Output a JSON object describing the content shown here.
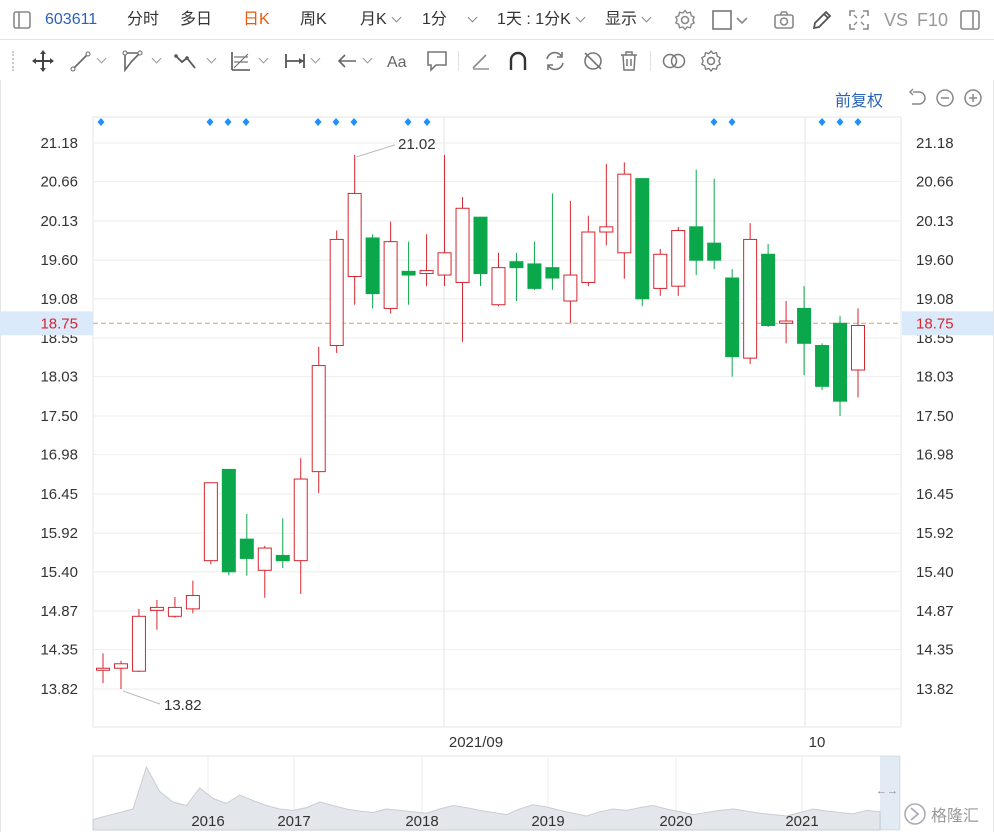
{
  "toolbar": {
    "stock_code": "603611",
    "tabs": [
      {
        "label": "分时",
        "active": false
      },
      {
        "label": "多日",
        "active": false
      },
      {
        "label": "日K",
        "active": true
      },
      {
        "label": "周K",
        "active": false
      },
      {
        "label": "月K",
        "active": false
      },
      {
        "label": "1分",
        "active": false
      }
    ],
    "period_select": "1天 : 1分K",
    "display_label": "显示",
    "vs_label": "VS",
    "f10_label": "F10"
  },
  "drawing_tools": [
    "move-icon",
    "line-tool-icon",
    "shape-tool-icon",
    "wave-tool-icon",
    "fib-tool-icon",
    "range-tool-icon",
    "arrow-tool-icon",
    "text-tool-icon",
    "note-tool-icon",
    "pen-tool-icon",
    "magnet-icon",
    "sync-icon",
    "hide-icon",
    "delete-icon",
    "compare-icon",
    "settings-icon"
  ],
  "price_mode": "前复权",
  "colors": {
    "up": "#d6262f",
    "down": "#0aa84b",
    "accent": "#2a62b8",
    "active_tab": "#e8590c",
    "current_line": "#e8a040",
    "marker": "#1e90ff"
  },
  "current_price": "18.75",
  "annotations": {
    "high": "21.02",
    "low": "13.82"
  },
  "date_labels": [
    "2021/09",
    "10"
  ],
  "overview_years": [
    "2016",
    "2017",
    "2018",
    "2019",
    "2020",
    "2021"
  ],
  "watermark": "格隆汇",
  "chart_data": {
    "type": "candlestick",
    "y_ticks": [
      "21.18",
      "20.66",
      "20.13",
      "19.60",
      "19.08",
      "18.55",
      "18.03",
      "17.50",
      "16.98",
      "16.45",
      "15.92",
      "15.40",
      "14.87",
      "14.35",
      "13.82"
    ],
    "ylim": [
      13.82,
      21.18
    ],
    "candles": [
      {
        "o": 14.08,
        "c": 14.1,
        "h": 14.3,
        "l": 13.9
      },
      {
        "o": 14.1,
        "c": 14.16,
        "h": 14.2,
        "l": 13.82
      },
      {
        "o": 14.06,
        "c": 14.8,
        "h": 14.9,
        "l": 14.05
      },
      {
        "o": 14.88,
        "c": 14.92,
        "h": 15.02,
        "l": 14.62
      },
      {
        "o": 14.8,
        "c": 14.92,
        "h": 15.06,
        "l": 14.78
      },
      {
        "o": 14.9,
        "c": 15.08,
        "h": 15.28,
        "l": 14.84
      },
      {
        "o": 15.55,
        "c": 16.6,
        "h": 16.6,
        "l": 15.5
      },
      {
        "o": 16.78,
        "c": 15.4,
        "h": 16.78,
        "l": 15.35
      },
      {
        "o": 15.84,
        "c": 15.58,
        "h": 16.18,
        "l": 15.35
      },
      {
        "o": 15.42,
        "c": 15.72,
        "h": 15.75,
        "l": 15.05
      },
      {
        "o": 15.62,
        "c": 15.55,
        "h": 16.12,
        "l": 15.45
      },
      {
        "o": 15.55,
        "c": 16.65,
        "h": 16.93,
        "l": 15.1
      },
      {
        "o": 16.75,
        "c": 18.18,
        "h": 18.43,
        "l": 16.46
      },
      {
        "o": 18.45,
        "c": 19.88,
        "h": 20.0,
        "l": 18.35
      },
      {
        "o": 19.38,
        "c": 20.5,
        "h": 21.02,
        "l": 19.0
      },
      {
        "o": 19.9,
        "c": 19.15,
        "h": 19.95,
        "l": 18.95
      },
      {
        "o": 18.95,
        "c": 19.85,
        "h": 20.12,
        "l": 18.88
      },
      {
        "o": 19.45,
        "c": 19.4,
        "h": 19.85,
        "l": 19.0
      },
      {
        "o": 19.42,
        "c": 19.46,
        "h": 19.95,
        "l": 19.25
      },
      {
        "o": 19.4,
        "c": 19.7,
        "h": 21.02,
        "l": 19.25
      },
      {
        "o": 19.3,
        "c": 20.3,
        "h": 20.45,
        "l": 18.5
      },
      {
        "o": 20.18,
        "c": 19.42,
        "h": 20.18,
        "l": 19.25
      },
      {
        "o": 19.0,
        "c": 19.5,
        "h": 19.7,
        "l": 18.98
      },
      {
        "o": 19.58,
        "c": 19.5,
        "h": 19.7,
        "l": 19.05
      },
      {
        "o": 19.55,
        "c": 19.22,
        "h": 19.85,
        "l": 19.2
      },
      {
        "o": 19.5,
        "c": 19.36,
        "h": 20.5,
        "l": 19.2
      },
      {
        "o": 19.05,
        "c": 19.4,
        "h": 20.4,
        "l": 18.75
      },
      {
        "o": 19.3,
        "c": 19.98,
        "h": 20.2,
        "l": 19.25
      },
      {
        "o": 19.98,
        "c": 20.05,
        "h": 20.9,
        "l": 19.8
      },
      {
        "o": 19.7,
        "c": 20.76,
        "h": 20.92,
        "l": 19.35
      },
      {
        "o": 20.7,
        "c": 19.08,
        "h": 20.7,
        "l": 18.98
      },
      {
        "o": 19.22,
        "c": 19.68,
        "h": 19.75,
        "l": 19.12
      },
      {
        "o": 19.25,
        "c": 20.0,
        "h": 20.05,
        "l": 19.12
      },
      {
        "o": 20.05,
        "c": 19.6,
        "h": 20.82,
        "l": 19.4
      },
      {
        "o": 19.83,
        "c": 19.6,
        "h": 20.7,
        "l": 19.48
      },
      {
        "o": 19.36,
        "c": 18.3,
        "h": 19.48,
        "l": 18.03
      },
      {
        "o": 18.28,
        "c": 19.88,
        "h": 20.1,
        "l": 18.2
      },
      {
        "o": 19.68,
        "c": 18.72,
        "h": 19.82,
        "l": 18.7
      },
      {
        "o": 18.75,
        "c": 18.78,
        "h": 19.05,
        "l": 18.48
      },
      {
        "o": 18.95,
        "c": 18.48,
        "h": 19.25,
        "l": 18.05
      },
      {
        "o": 18.45,
        "c": 17.9,
        "h": 18.48,
        "l": 17.85
      },
      {
        "o": 18.75,
        "c": 17.7,
        "h": 18.85,
        "l": 17.5
      },
      {
        "o": 18.12,
        "c": 18.72,
        "h": 18.95,
        "l": 17.75
      }
    ]
  }
}
